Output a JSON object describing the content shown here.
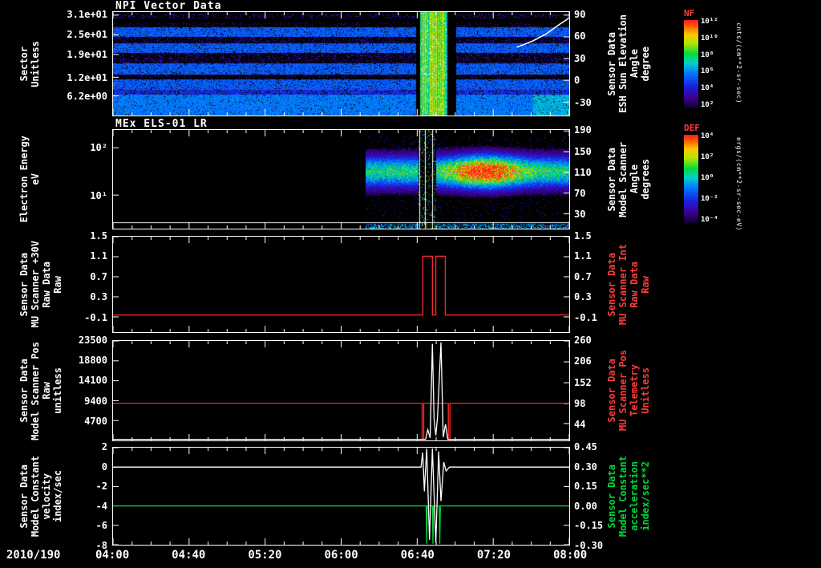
{
  "xaxis": {
    "date": "2010/190",
    "start_hour": 4,
    "end_hour": 8,
    "labels": [
      {
        "text": "04:00",
        "frac": 0.0
      },
      {
        "text": "04:40",
        "frac": 0.16667
      },
      {
        "text": "05:20",
        "frac": 0.33333
      },
      {
        "text": "06:00",
        "frac": 0.5
      },
      {
        "text": "06:40",
        "frac": 0.66667
      },
      {
        "text": "07:20",
        "frac": 0.83333
      },
      {
        "text": "08:00",
        "frac": 1.0
      }
    ]
  },
  "colorbars": [
    {
      "label": "NF",
      "units": "cnts/(cm**2-sr-sec)",
      "ticks": [
        "10¹²",
        "10¹⁰",
        "10⁸",
        "10⁶",
        "10⁴",
        "10²"
      ]
    },
    {
      "label": "DEF",
      "units": "ergs/(cm**2-sr-sec-eV)",
      "ticks": [
        "10⁴",
        "10²",
        "10⁰",
        "10⁻²",
        "10⁻⁴"
      ]
    }
  ],
  "chart_data": [
    {
      "id": "p1",
      "type": "heatmap",
      "title": "NPI Vector Data",
      "left_axis": {
        "lines": [
          "Sector",
          "Unitless"
        ],
        "ticks": [
          {
            "label": "3.1e+01",
            "frac": 0.03
          },
          {
            "label": "2.5e+01",
            "frac": 0.22
          },
          {
            "label": "1.9e+01",
            "frac": 0.41
          },
          {
            "label": "1.2e+01",
            "frac": 0.63
          },
          {
            "label": "6.2e+00",
            "frac": 0.81
          }
        ]
      },
      "right_axis": {
        "color": "#ffffff",
        "lines": [
          "Sensor Data",
          "ESH Sun Elevation",
          "Angle",
          "degree"
        ],
        "ticks": [
          {
            "label": "90",
            "frac": 0.03
          },
          {
            "label": "60",
            "frac": 0.24
          },
          {
            "label": "30",
            "frac": 0.45
          },
          {
            "label": "0",
            "frac": 0.66
          },
          {
            "label": "-30",
            "frac": 0.87
          }
        ]
      },
      "heatmap": {
        "bands": [
          {
            "y0": 0.015,
            "y1": 0.06,
            "style": "speckle"
          },
          {
            "y0": 0.1,
            "y1": 0.145,
            "style": "dark"
          },
          {
            "y0": 0.145,
            "y1": 0.24,
            "style": "bright"
          },
          {
            "y0": 0.24,
            "y1": 0.3,
            "style": "speckle"
          },
          {
            "y0": 0.3,
            "y1": 0.39,
            "style": "bright"
          },
          {
            "y0": 0.39,
            "y1": 0.49,
            "style": "speckle"
          },
          {
            "y0": 0.49,
            "y1": 0.6,
            "style": "bright"
          },
          {
            "y0": 0.6,
            "y1": 0.645,
            "style": "dark"
          },
          {
            "y0": 0.645,
            "y1": 0.745,
            "style": "bright"
          },
          {
            "y0": 0.745,
            "y1": 0.795,
            "style": "mid"
          },
          {
            "y0": 0.795,
            "y1": 0.995,
            "style": "bright2"
          }
        ],
        "event": {
          "black1": [
            0.664,
            0.673
          ],
          "stripe": [
            0.673,
            0.732
          ],
          "black2": [
            0.732,
            0.752
          ]
        },
        "white_curve": [
          [
            0.885,
            0.34
          ],
          [
            0.92,
            0.28
          ],
          [
            0.95,
            0.21
          ],
          [
            0.975,
            0.13
          ],
          [
            0.999,
            0.06
          ]
        ]
      }
    },
    {
      "id": "p2",
      "type": "heatmap",
      "title": "MEx ELS-01 LR",
      "left_axis": {
        "lines": [
          "Electron Energy",
          "eV"
        ],
        "ticks": [
          {
            "label": "10²",
            "frac": 0.18
          },
          {
            "label": "10¹",
            "frac": 0.66
          }
        ]
      },
      "right_axis": {
        "color": "#ffffff",
        "lines": [
          "Sensor Data",
          "Model Scanner",
          "Angle",
          "degrees"
        ],
        "ticks": [
          {
            "label": "190",
            "frac": 0.01
          },
          {
            "label": "150",
            "frac": 0.22
          },
          {
            "label": "110",
            "frac": 0.43
          },
          {
            "label": "70",
            "frac": 0.64
          },
          {
            "label": "30",
            "frac": 0.85
          }
        ]
      },
      "spectrogram": {
        "x_start": 0.553,
        "band_center": 0.42,
        "band_width": 0.11,
        "blob_x": 0.815,
        "blob_sx": 0.05,
        "base_peak": 0.5,
        "blob_peak": 0.45,
        "event": [
          0.668,
          0.708
        ],
        "white_lines": [
          0.671,
          0.684,
          0.7
        ],
        "hline_y": 0.935
      }
    },
    {
      "id": "p3",
      "type": "line",
      "ymin": -0.45,
      "ymax": 1.5,
      "left_axis": {
        "lines": [
          "Sensor Data",
          "MU Scanner +30V",
          "Raw Data",
          "Raw"
        ],
        "ticks": [
          {
            "label": "1.5",
            "frac": 0.0
          },
          {
            "label": "1.1",
            "frac": 0.21
          },
          {
            "label": "0.7",
            "frac": 0.42
          },
          {
            "label": "0.3",
            "frac": 0.63
          },
          {
            "label": "-0.1",
            "frac": 0.84
          }
        ]
      },
      "right_axis": {
        "color": "#ff3b3b",
        "lines": [
          "Sensor Data",
          "MU Scanner Int",
          "Raw Data",
          "Raw"
        ],
        "ticks": [
          {
            "label": "1.5",
            "frac": 0.0
          },
          {
            "label": "1.1",
            "frac": 0.21
          },
          {
            "label": "0.7",
            "frac": 0.42
          },
          {
            "label": "0.3",
            "frac": 0.63
          },
          {
            "label": "-0.1",
            "frac": 0.84
          }
        ]
      },
      "series": [
        {
          "name": "MU Scanner +30V Raw",
          "color": "#ff2a2a",
          "points": [
            [
              4,
              -0.1
            ],
            [
              6.716,
              -0.1
            ],
            [
              6.716,
              1.1
            ],
            [
              6.8,
              1.1
            ],
            [
              6.8,
              -0.1
            ],
            [
              6.83,
              -0.1
            ],
            [
              6.83,
              1.1
            ],
            [
              6.913,
              1.1
            ],
            [
              6.913,
              -0.1
            ],
            [
              8,
              -0.1
            ]
          ]
        }
      ]
    },
    {
      "id": "p4",
      "type": "line",
      "ymin": 0,
      "ymax": 23500,
      "left_axis": {
        "lines": [
          "Sensor Data",
          "Model Scanner Pos",
          "Raw",
          "unitless"
        ],
        "ticks": [
          {
            "label": "23500",
            "frac": 0.0
          },
          {
            "label": "18800",
            "frac": 0.2
          },
          {
            "label": "14100",
            "frac": 0.4
          },
          {
            "label": "9400",
            "frac": 0.6
          },
          {
            "label": "4700",
            "frac": 0.8
          }
        ]
      },
      "right_axis": {
        "color": "#ff3b3b",
        "lines": [
          "Sensor Data",
          "MU Scanner Pos",
          "Telemetry",
          "Unitless"
        ],
        "ticks": [
          {
            "label": "260",
            "frac": 0.0
          },
          {
            "label": "206",
            "frac": 0.21
          },
          {
            "label": "152",
            "frac": 0.42
          },
          {
            "label": "98",
            "frac": 0.63
          },
          {
            "label": "44",
            "frac": 0.83
          }
        ]
      },
      "series": [
        {
          "name": "Model Scanner Pos Raw",
          "color": "#ff2a2a",
          "points": [
            [
              4,
              8800
            ],
            [
              6.71,
              8800
            ],
            [
              6.71,
              400
            ],
            [
              6.724,
              400
            ],
            [
              6.724,
              8800
            ],
            [
              6.94,
              8800
            ],
            [
              6.94,
              400
            ],
            [
              6.954,
              400
            ],
            [
              6.954,
              8800
            ],
            [
              8,
              8800
            ]
          ]
        },
        {
          "name": "MU Scanner Pos Telemetry",
          "color": "#ffffff",
          "points": [
            [
              4,
              260
            ],
            [
              6.74,
              260
            ],
            [
              6.76,
              2500
            ],
            [
              6.78,
              600
            ],
            [
              6.8,
              22800
            ],
            [
              6.815,
              5000
            ],
            [
              6.83,
              1200
            ],
            [
              6.845,
              5500
            ],
            [
              6.875,
              23200
            ],
            [
              6.895,
              800
            ],
            [
              6.915,
              3800
            ],
            [
              6.935,
              260
            ],
            [
              8,
              260
            ]
          ]
        }
      ]
    },
    {
      "id": "p5",
      "type": "line",
      "ymin": -8,
      "ymax": 2,
      "left_axis": {
        "lines": [
          "Sensor Data",
          "Model Constant",
          "velocity",
          "index/sec"
        ],
        "ticks": [
          {
            "label": "2",
            "frac": 0.0
          },
          {
            "label": "0",
            "frac": 0.2
          },
          {
            "label": "-2",
            "frac": 0.4
          },
          {
            "label": "-4",
            "frac": 0.6
          },
          {
            "label": "-6",
            "frac": 0.8
          },
          {
            "label": "-8",
            "frac": 1.0
          }
        ]
      },
      "right_axis": {
        "color": "#00d838",
        "lines": [
          "Sensor Data",
          "Model Constant",
          "acceleration",
          "index/sec**2"
        ],
        "ticks": [
          {
            "label": "0.45",
            "frac": 0.0
          },
          {
            "label": "0.30",
            "frac": 0.2
          },
          {
            "label": "0.15",
            "frac": 0.4
          },
          {
            "label": "0.00",
            "frac": 0.6
          },
          {
            "label": "-0.15",
            "frac": 0.8
          },
          {
            "label": "-0.30",
            "frac": 1.0
          }
        ]
      },
      "series": [
        {
          "name": "Model Constant acceleration",
          "color": "#00d838",
          "points": [
            [
              4,
              -4
            ],
            [
              6.745,
              -4
            ],
            [
              6.75,
              -7.9
            ],
            [
              6.755,
              -4
            ],
            [
              6.8,
              -4
            ],
            [
              6.805,
              -7.9
            ],
            [
              6.81,
              -4
            ],
            [
              6.86,
              -4
            ],
            [
              6.865,
              -7.9
            ],
            [
              6.87,
              -4
            ],
            [
              8,
              -4
            ]
          ]
        },
        {
          "name": "Model Constant velocity",
          "color": "#ffffff",
          "points": [
            [
              4,
              0
            ],
            [
              6.7,
              0
            ],
            [
              6.715,
              1.5
            ],
            [
              6.73,
              -2.5
            ],
            [
              6.75,
              1.9
            ],
            [
              6.775,
              -7.5
            ],
            [
              6.8,
              1.9
            ],
            [
              6.83,
              -7.8
            ],
            [
              6.855,
              1.6
            ],
            [
              6.875,
              -3.5
            ],
            [
              6.9,
              0.5
            ],
            [
              6.92,
              -0.4
            ],
            [
              6.95,
              0
            ],
            [
              8,
              0
            ]
          ]
        }
      ]
    }
  ]
}
